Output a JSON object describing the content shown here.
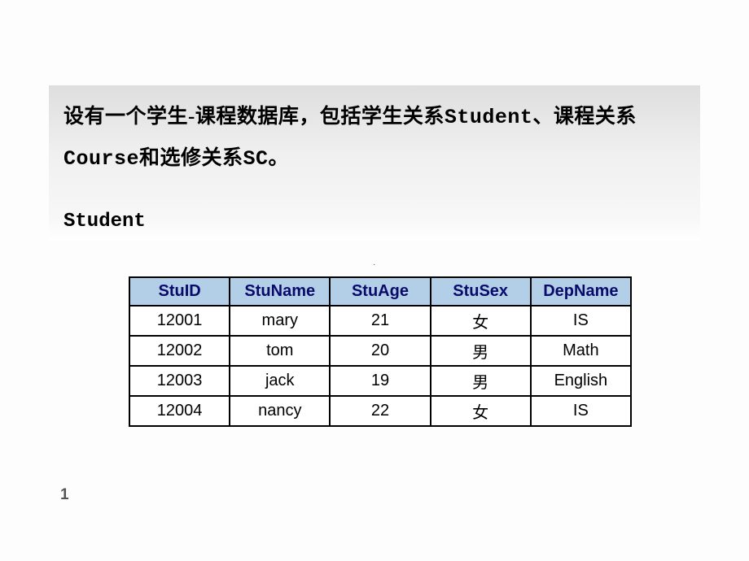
{
  "header": {
    "text_part1": "设有一个学生-课程数据库，包括学生关系",
    "text_mono1": "Student",
    "text_part2": "、课程关系",
    "text_mono2": "Course",
    "text_part3": "和选修关系",
    "text_mono3": "SC",
    "text_part4": "。",
    "table_label": "Student"
  },
  "table": {
    "headers": [
      "StuID",
      "StuName",
      "StuAge",
      "StuSex",
      "DepName"
    ],
    "rows": [
      [
        "12001",
        "mary",
        "21",
        "女",
        "IS"
      ],
      [
        "12002",
        "tom",
        "20",
        "男",
        "Math"
      ],
      [
        "12003",
        "jack",
        "19",
        "男",
        "English"
      ],
      [
        "12004",
        "nancy",
        "22",
        "女",
        "IS"
      ]
    ]
  },
  "page_number": "1",
  "center_dot": "·"
}
